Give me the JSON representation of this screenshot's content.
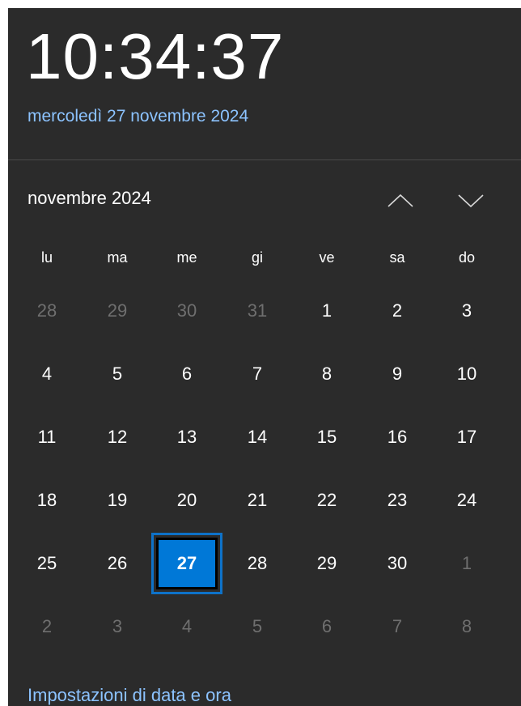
{
  "clock": {
    "time": "10:34:37",
    "date": "mercoledì 27 novembre 2024"
  },
  "calendar": {
    "month_title": "novembre 2024",
    "nav": {
      "up_icon": "chevron-up-icon",
      "down_icon": "chevron-down-icon"
    },
    "weekdays": [
      "lu",
      "ma",
      "me",
      "gi",
      "ve",
      "sa",
      "do"
    ],
    "weeks": [
      [
        {
          "d": "28",
          "other": true
        },
        {
          "d": "29",
          "other": true
        },
        {
          "d": "30",
          "other": true
        },
        {
          "d": "31",
          "other": true
        },
        {
          "d": "1"
        },
        {
          "d": "2"
        },
        {
          "d": "3"
        }
      ],
      [
        {
          "d": "4"
        },
        {
          "d": "5"
        },
        {
          "d": "6"
        },
        {
          "d": "7"
        },
        {
          "d": "8"
        },
        {
          "d": "9"
        },
        {
          "d": "10"
        }
      ],
      [
        {
          "d": "11"
        },
        {
          "d": "12"
        },
        {
          "d": "13"
        },
        {
          "d": "14"
        },
        {
          "d": "15"
        },
        {
          "d": "16"
        },
        {
          "d": "17"
        }
      ],
      [
        {
          "d": "18"
        },
        {
          "d": "19"
        },
        {
          "d": "20"
        },
        {
          "d": "21"
        },
        {
          "d": "22"
        },
        {
          "d": "23"
        },
        {
          "d": "24"
        }
      ],
      [
        {
          "d": "25"
        },
        {
          "d": "26"
        },
        {
          "d": "27",
          "today": true
        },
        {
          "d": "28"
        },
        {
          "d": "29"
        },
        {
          "d": "30"
        },
        {
          "d": "1",
          "other": true
        }
      ],
      [
        {
          "d": "2",
          "other": true
        },
        {
          "d": "3",
          "other": true
        },
        {
          "d": "4",
          "other": true
        },
        {
          "d": "5",
          "other": true
        },
        {
          "d": "6",
          "other": true
        },
        {
          "d": "7",
          "other": true
        },
        {
          "d": "8",
          "other": true
        }
      ]
    ],
    "selected_day": "27"
  },
  "footer": {
    "settings_link": "Impostazioni di data e ora"
  },
  "colors": {
    "background": "#2b2b2b",
    "link": "#8cc3ff",
    "accent": "#0078d7",
    "muted_text": "#6f6f6f",
    "text": "#ffffff"
  }
}
